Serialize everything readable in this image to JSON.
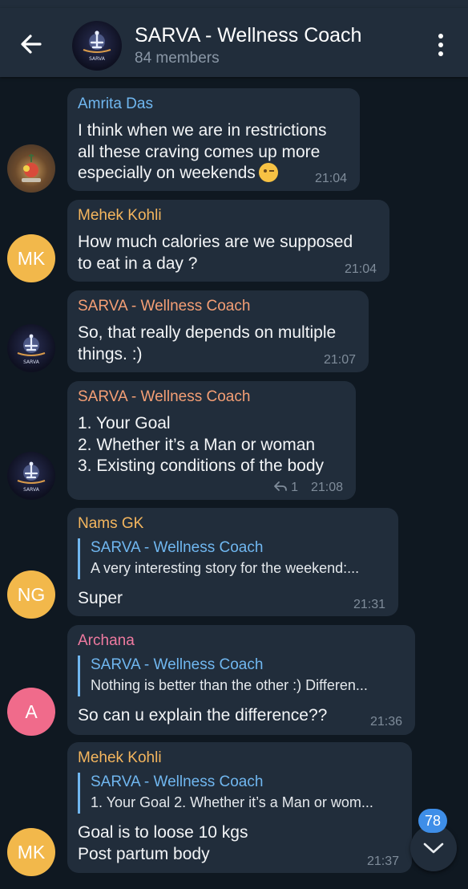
{
  "header": {
    "title": "SARVA - Wellness Coach",
    "subtitle": "84 members",
    "avatar_text": "SARVA"
  },
  "messages": [
    {
      "sender": "Amrita Das",
      "lines": [
        "I think when we are in restrictions",
        "all these craving comes up more",
        "especially on weekends"
      ],
      "emoji": "winking-face",
      "time": "21:04"
    },
    {
      "sender": "Mehek Kohli",
      "avatar_initials": "MK",
      "lines": [
        "How much calories are we supposed",
        "to eat in a day ?"
      ],
      "time": "21:04"
    },
    {
      "sender": "SARVA - Wellness Coach",
      "avatar_text": "SARVA",
      "lines": [
        "So, that really depends on multiple",
        "things. :)"
      ],
      "time": "21:07"
    },
    {
      "sender": "SARVA - Wellness Coach",
      "avatar_text": "SARVA",
      "lines": [
        "1. Your Goal",
        "2. Whether it’s a Man or woman",
        "3. Existing conditions of the body"
      ],
      "reply_count": "1",
      "time": "21:08"
    },
    {
      "sender": "Nams GK",
      "avatar_initials": "NG",
      "reply_to": {
        "name": "SARVA - Wellness Coach",
        "text": "A very interesting story for the weekend:..."
      },
      "lines": [
        "Super"
      ],
      "time": "21:31"
    },
    {
      "sender": "Archana",
      "avatar_initials": "A",
      "reply_to": {
        "name": "SARVA - Wellness Coach",
        "text": "Nothing is better than the other :)  Differen..."
      },
      "lines": [
        "So can  u explain the  difference??"
      ],
      "time": "21:36"
    },
    {
      "sender": "Mehek Kohli",
      "avatar_initials": "MK",
      "reply_to": {
        "name": "SARVA - Wellness Coach",
        "text": "1. Your Goal  2. Whether it’s a Man or wom..."
      },
      "lines": [
        "Goal is to loose 10 kgs",
        "Post partum body"
      ],
      "time": "21:37"
    }
  ],
  "scroll_down": {
    "unread_count": "78"
  },
  "colors": {
    "background": "#0f1821",
    "bubble": "#212d3b",
    "accent": "#70b7f0",
    "badge": "#3e8ee8"
  }
}
